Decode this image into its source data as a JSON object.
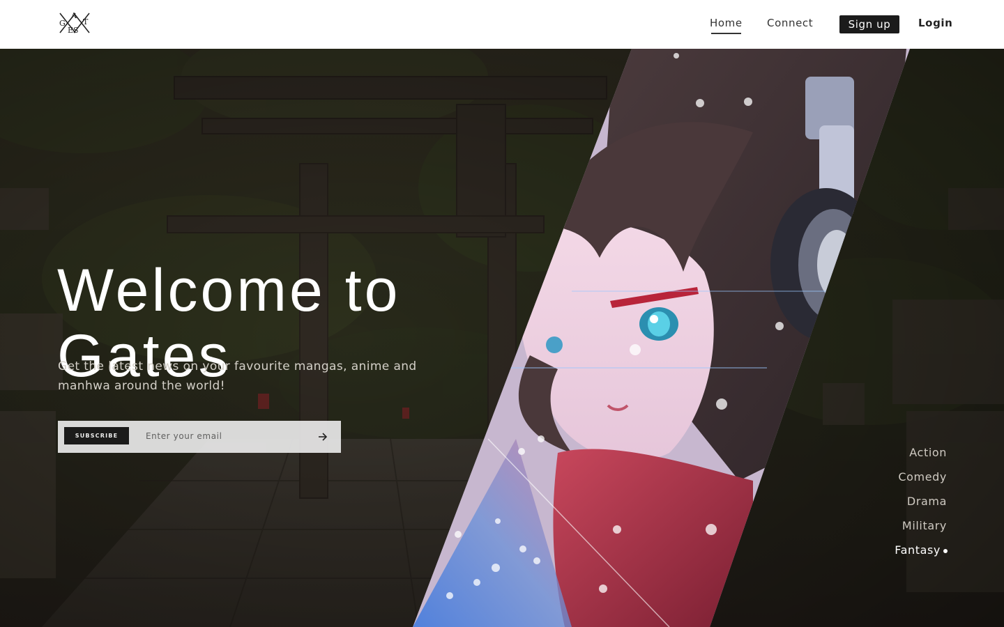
{
  "logo": {
    "letters": [
      "A",
      "G",
      "T",
      "ES"
    ]
  },
  "nav": {
    "home": "Home",
    "connect": "Connect",
    "signup": "Sign up",
    "login": "Login"
  },
  "hero": {
    "title_line1": "Welcome to",
    "title_line2": "Gates",
    "subtitle": "Get the latest news on your favourite mangas, anime and manhwa around the world!",
    "subscribe_label": "SUBSCRIBE",
    "email_placeholder": "Enter your email",
    "submit_icon": "arrow-right-icon"
  },
  "genres": {
    "items": [
      "Action",
      "Comedy",
      "Drama",
      "Military",
      "Fantasy"
    ],
    "active": "Fantasy"
  },
  "colors": {
    "header_bg": "#ffffff",
    "dark": "#1b1b1b",
    "hero_overlay": "#2a241c",
    "accent_blue": "#3a7de0",
    "scarf_red": "#b8334a"
  }
}
